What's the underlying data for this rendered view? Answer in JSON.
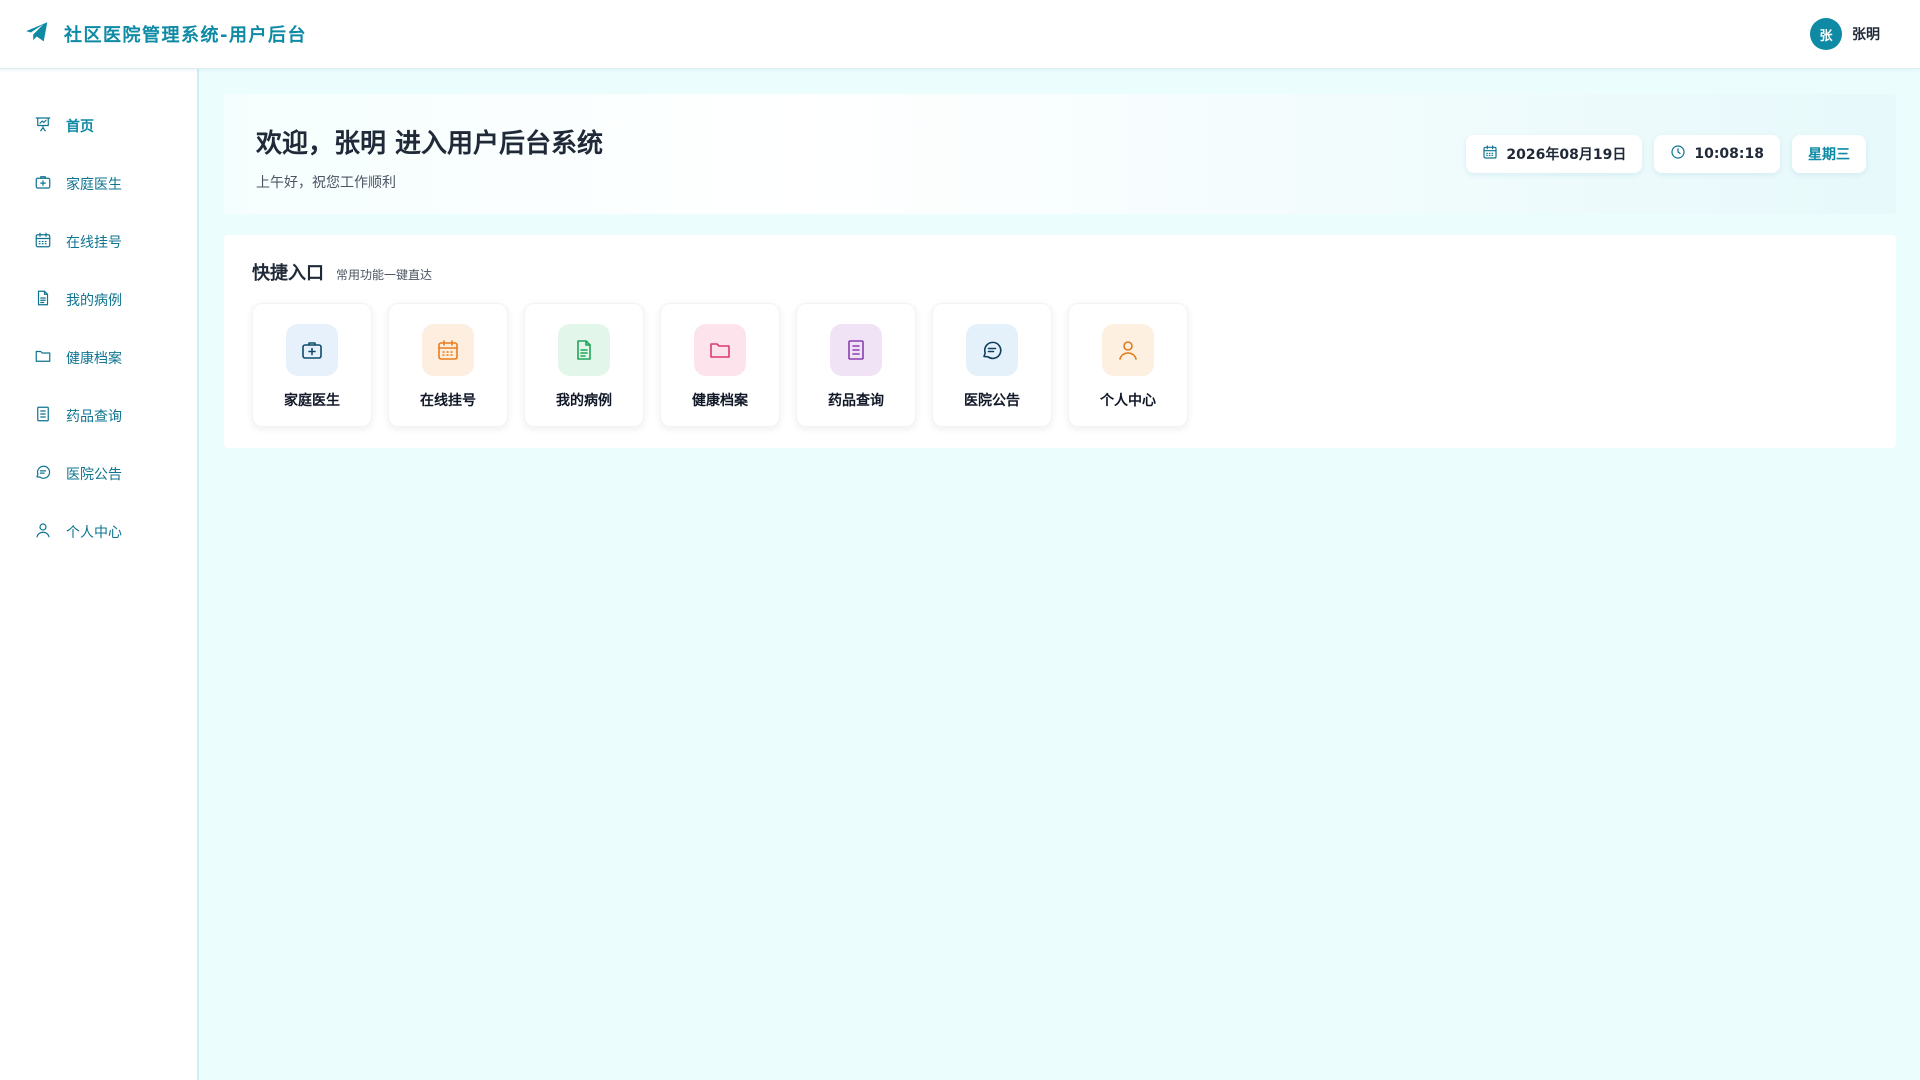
{
  "header": {
    "title": "社区医院管理系统-用户后台",
    "logo_icon": "paper-plane-icon",
    "user": {
      "avatar_text": "张",
      "name": "张明"
    }
  },
  "sidebar": {
    "items": [
      {
        "label": "首页",
        "icon": "presentation-chart-icon",
        "active": true
      },
      {
        "label": "家庭医生",
        "icon": "medical-kit-icon"
      },
      {
        "label": "在线挂号",
        "icon": "calendar-icon"
      },
      {
        "label": "我的病例",
        "icon": "document-icon"
      },
      {
        "label": "健康档案",
        "icon": "folder-icon"
      },
      {
        "label": "药品查询",
        "icon": "list-document-icon"
      },
      {
        "label": "医院公告",
        "icon": "message-icon"
      },
      {
        "label": "个人中心",
        "icon": "user-icon"
      }
    ]
  },
  "welcome": {
    "title": "欢迎，张明 进入用户后台系统",
    "subtitle": "上午好，祝您工作顺利",
    "date": "2026年08月19日",
    "time": "10:08:18",
    "weekday": "星期三"
  },
  "quick": {
    "title": "快捷入口",
    "subtitle": "常用功能一键直达",
    "tiles": [
      {
        "label": "家庭医生",
        "icon": "medical-kit-icon",
        "color": "#0f4c6e",
        "bg": "#e6f1fb"
      },
      {
        "label": "在线挂号",
        "icon": "calendar-icon",
        "color": "#ea7d1c",
        "bg": "#fdeee0"
      },
      {
        "label": "我的病例",
        "icon": "document-icon",
        "color": "#22a55a",
        "bg": "#e2f6ea"
      },
      {
        "label": "健康档案",
        "icon": "folder-icon",
        "color": "#de3b6c",
        "bg": "#fce3ec"
      },
      {
        "label": "药品查询",
        "icon": "list-document-icon",
        "color": "#8a3fb0",
        "bg": "#f1e3f6"
      },
      {
        "label": "医院公告",
        "icon": "message-icon",
        "color": "#103e5e",
        "bg": "#e4f1fb"
      },
      {
        "label": "个人中心",
        "icon": "user-icon",
        "color": "#e07c1e",
        "bg": "#fdf0e1"
      }
    ]
  },
  "colors": {
    "accent": "#0e8aa5",
    "background": "#ecfdfd"
  }
}
